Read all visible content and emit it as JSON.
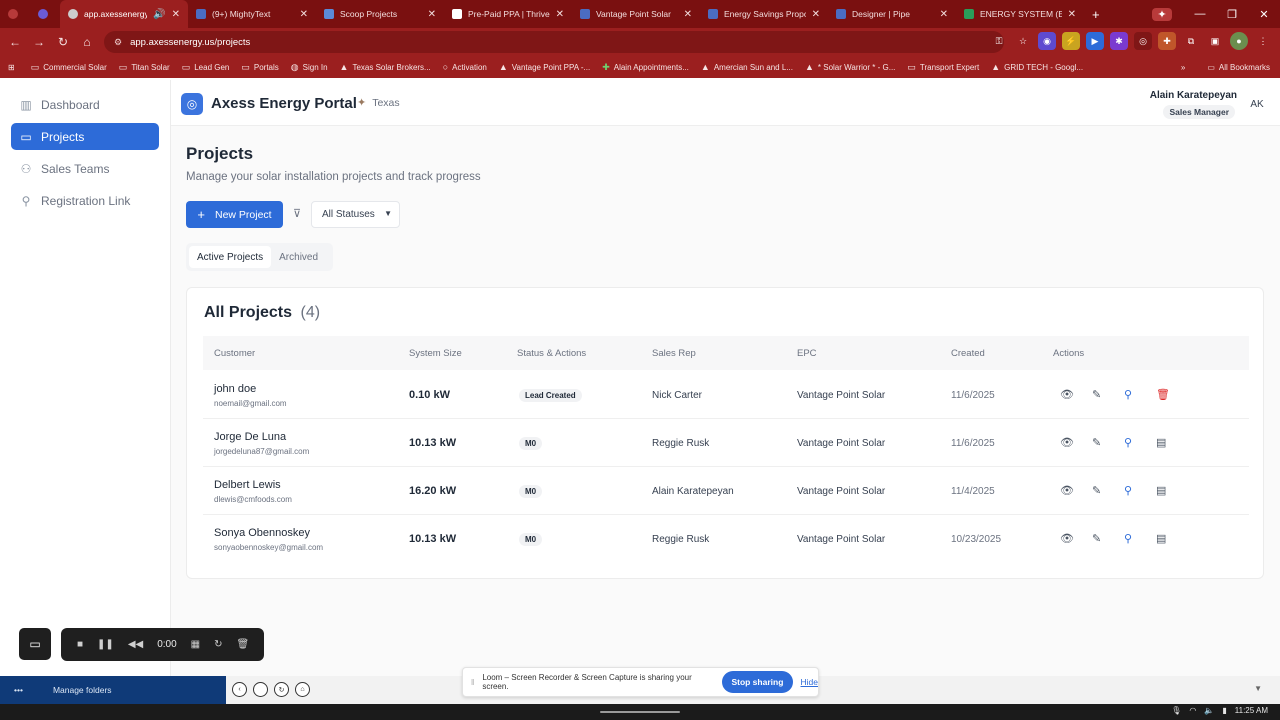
{
  "browser": {
    "tabs": [
      {
        "label": "",
        "color": "#b73a3a"
      },
      {
        "label": "",
        "color": "#6b5bd6"
      },
      {
        "label": "app.axessenergy.us",
        "color": "#cccccc",
        "active": true
      },
      {
        "label": "(9+) MightyText",
        "color": "#4b6cc2"
      },
      {
        "label": "Scoop Projects",
        "color": "#5b8ad8"
      },
      {
        "label": "Pre-Paid PPA | Thrive P",
        "color": "#ffffff"
      },
      {
        "label": "Vantage Point Solar",
        "color": "#4b6cc2"
      },
      {
        "label": "Energy Savings Propos",
        "color": "#4b6cc2"
      },
      {
        "label": "Designer | Pipe",
        "color": "#4b6cc2"
      },
      {
        "label": "ENERGY SYSTEM (ESA",
        "color": "#2a9d5a"
      }
    ],
    "url": "app.axessenergy.us/projects",
    "bookmarks": [
      {
        "icon": "folder-icon",
        "label": "Commercial Solar"
      },
      {
        "icon": "folder-icon",
        "label": "Titan Solar"
      },
      {
        "icon": "folder-icon",
        "label": "Lead Gen"
      },
      {
        "icon": "folder-icon",
        "label": "Portals"
      },
      {
        "icon": "globe-icon",
        "label": "Sign In"
      },
      {
        "icon": "drive-icon",
        "label": "Texas Solar Brokers..."
      },
      {
        "icon": "circle-icon",
        "label": "Activation"
      },
      {
        "icon": "drive-icon",
        "label": "Vantage Point PPA -..."
      },
      {
        "icon": "plus-icon",
        "label": "Alain Appointments..."
      },
      {
        "icon": "drive-icon",
        "label": "Amercian Sun and L..."
      },
      {
        "icon": "drive-icon",
        "label": "* Solar Warrior * - G..."
      },
      {
        "icon": "folder-icon",
        "label": "Transport Expert"
      },
      {
        "icon": "drive-icon",
        "label": "GRID TECH - Googl..."
      }
    ],
    "all_bookmarks": "All Bookmarks"
  },
  "sidebar": {
    "items": [
      {
        "label": "Dashboard",
        "icon": "bar-chart-icon"
      },
      {
        "label": "Projects",
        "icon": "folder-icon",
        "active": true
      },
      {
        "label": "Sales Teams",
        "icon": "users-icon"
      },
      {
        "label": "Registration Link",
        "icon": "user-plus-icon"
      }
    ]
  },
  "header": {
    "title": "Axess Energy Portal",
    "state": "Texas",
    "user_name": "Alain Karatepeyan",
    "user_role": "Sales Manager",
    "avatar": "AK"
  },
  "page": {
    "title": "Projects",
    "subtitle": "Manage your solar installation projects and track progress",
    "new_button": "New Project",
    "status_filter": "All Statuses",
    "tabs": [
      "Active Projects",
      "Archived"
    ]
  },
  "table": {
    "title": "All Projects",
    "count": "(4)",
    "columns": [
      "Customer",
      "System Size",
      "Status & Actions",
      "Sales Rep",
      "EPC",
      "Created",
      "Actions"
    ],
    "rows": [
      {
        "name": "john doe",
        "email": "noemail@gmail.com",
        "size": "0.10 kW",
        "status": "Lead Created",
        "rep": "Nick Carter",
        "epc": "Vantage Point Solar",
        "created": "11/6/2025"
      },
      {
        "name": "Jorge De Luna",
        "email": "jorgedeluna87@gmail.com",
        "size": "10.13 kW",
        "status": "M0",
        "rep": "Reggie Rusk",
        "epc": "Vantage Point Solar",
        "created": "11/6/2025"
      },
      {
        "name": "Delbert Lewis",
        "email": "dlewis@cmfoods.com",
        "size": "16.20 kW",
        "status": "M0",
        "rep": "Alain Karatepeyan",
        "epc": "Vantage Point Solar",
        "created": "11/4/2025"
      },
      {
        "name": "Sonya Obennoskey",
        "email": "sonyaobennoskey@gmail.com",
        "size": "10.13 kW",
        "status": "M0",
        "rep": "Reggie Rusk",
        "epc": "Vantage Point Solar",
        "created": "10/23/2025"
      }
    ]
  },
  "recorder": {
    "time": "0:00"
  },
  "loom": {
    "message": "Loom – Screen Recorder & Screen Capture is sharing your screen.",
    "stop": "Stop sharing",
    "hide": "Hide"
  },
  "taskbar": {
    "manage_folders": "Manage folders",
    "clock": "11:25 AM"
  },
  "colors": {
    "primary": "#2d6bd8",
    "chrome": "#9b1f1f",
    "danger": "#dc2626"
  }
}
